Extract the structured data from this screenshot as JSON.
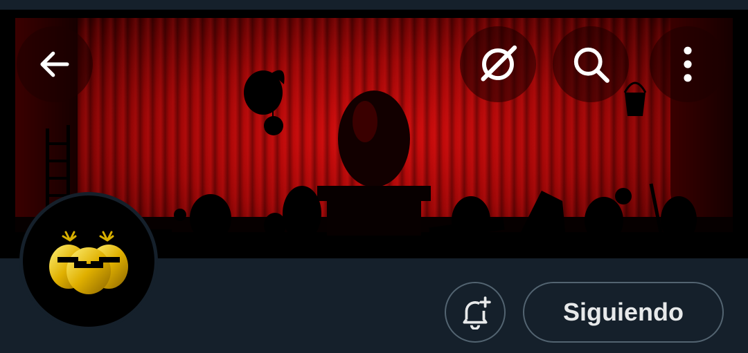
{
  "header": {
    "back_icon": "arrow-left-icon",
    "grok_icon": "grok-icon",
    "search_icon": "search-icon",
    "more_icon": "more-vertical-icon"
  },
  "banner": {
    "description_colors": {
      "curtain": "#b00808",
      "silhouette": "#000000"
    }
  },
  "profile": {
    "avatar_colors": {
      "egg": "#e0b000",
      "background": "#000000"
    }
  },
  "actions": {
    "notify_icon": "bell-plus-icon",
    "follow_label": "Siguiendo"
  },
  "theme": {
    "background": "#15202b",
    "border": "#536471",
    "text": "#e7e9ea"
  }
}
